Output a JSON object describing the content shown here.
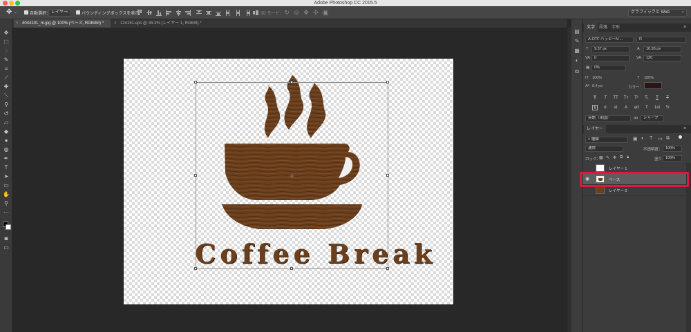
{
  "window": {
    "title": "Adobe Photoshop CC 2015.5"
  },
  "options_bar": {
    "auto_select_label": "自動選択：",
    "auto_select_target": "レイヤー",
    "show_transform_label": "バウンディングボックスを表示",
    "mode_3d_label": "3D モード：",
    "workspace": "グラフィックと Web"
  },
  "tabs": [
    {
      "label": "4044101_m.jpg @ 100% (ベース, RGB/8#) *"
    },
    {
      "label": "124151.eps @ 35.3% (レイヤー 1, RGB/8) *"
    }
  ],
  "canvas": {
    "headline": "Coffee Break"
  },
  "character_panel": {
    "tabs": [
      "文字",
      "段落",
      "字形"
    ],
    "font_family": "A-OTF ハッピーN ...",
    "font_style": "R",
    "font_size": "9.37 px",
    "leading": "10.95 px",
    "kerning": "0",
    "tracking": "120",
    "tsume": "0%",
    "vertical_scale": "100%",
    "horizontal_scale": "100%",
    "baseline_shift": "6.4 px",
    "color_label": "カラー：",
    "color_swatch": "#2a1612",
    "format_buttons": [
      "T",
      "T",
      "TT",
      "Tт",
      "T¹",
      "T₁",
      "T",
      "T"
    ],
    "opentype_buttons": [
      "fi",
      "σ",
      "st",
      "A",
      "ad",
      "T",
      "1st",
      "½"
    ],
    "language": "英語（米国）",
    "antialias_symbol": "aa",
    "antialias": "シャープ"
  },
  "layers_panel": {
    "tab": "レイヤー",
    "filter": "種類",
    "blend_mode": "通常",
    "opacity_label": "不透明度：",
    "opacity": "100%",
    "lock_label": "ロック：",
    "fill_label": "塗り：",
    "fill": "100%",
    "layers": [
      {
        "name": "レイヤー 1",
        "visible": false,
        "selected": false
      },
      {
        "name": "ベース",
        "visible": true,
        "selected": true
      },
      {
        "name": "レイヤー 0",
        "visible": false,
        "selected": false
      }
    ]
  },
  "colors": {
    "highlight_box": "#e0183c",
    "wood": "#6a3f1d"
  }
}
